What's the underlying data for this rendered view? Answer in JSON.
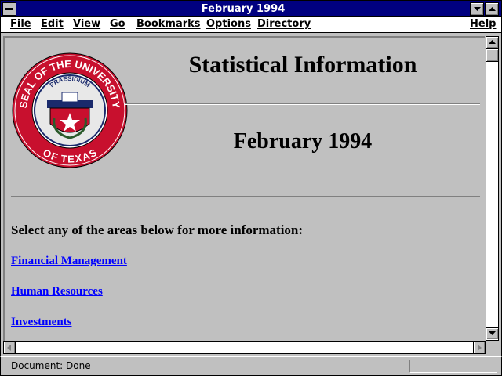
{
  "window": {
    "title": "February 1994"
  },
  "menu": [
    "File",
    "Edit",
    "View",
    "Go",
    "Bookmarks",
    "Options",
    "Directory",
    "Help"
  ],
  "page": {
    "heading": "Statistical Information",
    "subheading": "February 1994",
    "intro": "Select any of the areas below for more information:",
    "links": [
      "Financial Management",
      "Human Resources",
      "Investments"
    ]
  },
  "seal": {
    "outer_text": "SEAL OF THE UNIVERSITY OF TEXAS",
    "inner_text": "PRAESIDIUM",
    "motto": "DISCIPLINA CIVITATIS"
  },
  "status": {
    "text": "Document: Done",
    "progress": 0
  },
  "icons": [
    "system-menu-icon",
    "minimize-icon",
    "maximize-icon",
    "scroll-up-icon",
    "scroll-down-icon",
    "scroll-left-icon",
    "scroll-right-icon"
  ],
  "colors": {
    "titlebar": "#000080",
    "link": "#0000ff",
    "seal_red": "#c8102e",
    "chrome": "#c0c0c0"
  }
}
